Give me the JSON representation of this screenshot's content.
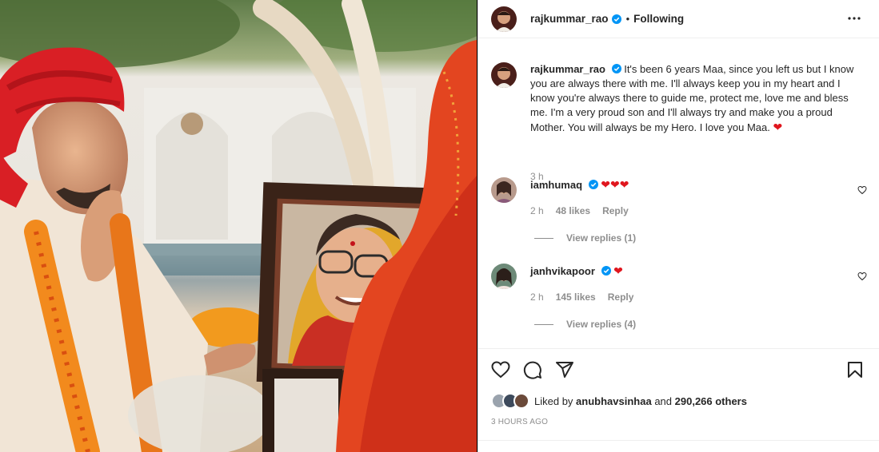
{
  "post": {
    "author": "rajkummar_rao",
    "follow_status": "Following",
    "separator": "•",
    "caption": "It's been 6 years Maa, since you left us but I know you are always there with me. I'll always keep you in my heart and I know you're always there to guide me, protect me, love me and bless me. I'm a very proud son and I'll always try and make you a proud Mother. You will always be my Hero. I love you Maa.",
    "caption_emoji": "❤",
    "caption_age": "3 h"
  },
  "comments": [
    {
      "username": "iamhumaq",
      "text": "❤❤❤",
      "age": "2 h",
      "likes": "48 likes",
      "reply_label": "Reply",
      "view_replies": "View replies (1)"
    },
    {
      "username": "janhvikapoor",
      "text": "❤",
      "age": "2 h",
      "likes": "145 likes",
      "reply_label": "Reply",
      "view_replies": "View replies (4)"
    }
  ],
  "engagement": {
    "liked_prefix": "Liked by",
    "liked_user": "anubhavsinhaa",
    "liked_and": "and",
    "liked_count": "290,266 others",
    "timestamp": "3 HOURS AGO"
  },
  "icons": {
    "like": "heart-icon",
    "comment": "comment-icon",
    "share": "share-icon",
    "save": "bookmark-icon",
    "more": "more-options-icon",
    "verified": "verified-badge-icon"
  },
  "colors": {
    "verified_blue": "#0095f6",
    "heart_red": "#e0161e",
    "muted_text": "#8e8e8e",
    "border": "#dbdbdb"
  }
}
